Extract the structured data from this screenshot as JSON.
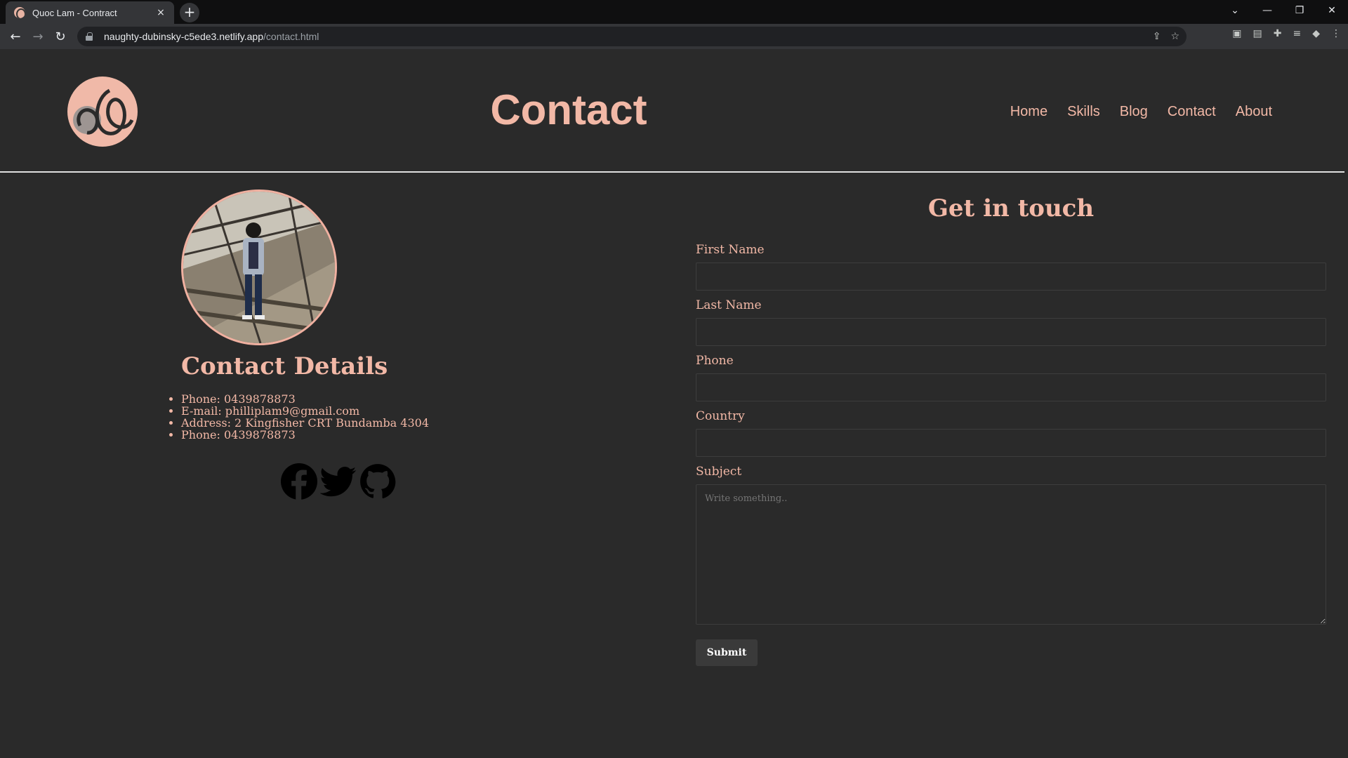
{
  "browser": {
    "tab_title": "Quoc Lam - Contract",
    "tab_close": "×",
    "new_tab": "+",
    "url_host": "naughty-dubinsky-c5ede3.netlify.app",
    "url_path": "/contact.html",
    "window_controls": [
      "⌄",
      "—",
      "❐",
      "✕"
    ],
    "nav": {
      "back": "←",
      "forward": "→",
      "reload": "↻"
    }
  },
  "header": {
    "title": "Contact",
    "nav": [
      "Home",
      "Skills",
      "Blog",
      "Contact",
      "About"
    ]
  },
  "contact_details": {
    "title": "Contact Details",
    "items": [
      "Phone: 0439878873",
      "E-mail: philliplam9@gmail.com",
      "Address: 2 Kingfisher CRT Bundamba 4304",
      "Phone: 0439878873"
    ],
    "social_icons": [
      "facebook-icon",
      "twitter-icon",
      "github-icon"
    ]
  },
  "form": {
    "title": "Get in touch",
    "first_name_label": "First Name",
    "last_name_label": "Last Name",
    "phone_label": "Phone",
    "country_label": "Country",
    "subject_label": "Subject",
    "subject_placeholder": "Write something..",
    "submit_label": "Submit"
  },
  "colors": {
    "accent": "#f2b8a6",
    "background": "#2a2a2a"
  }
}
